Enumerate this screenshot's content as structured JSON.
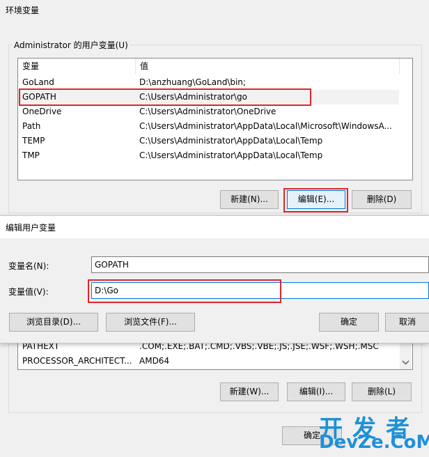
{
  "window": {
    "title": "环境变量"
  },
  "user_vars": {
    "group_label": "Administrator 的用户变量(U)",
    "col_name": "变量",
    "col_value": "值",
    "rows": [
      {
        "name": "GoLand",
        "value": "D:\\anzhuang\\GoLand\\bin;"
      },
      {
        "name": "GOPATH",
        "value": "C:\\Users\\Administrator\\go"
      },
      {
        "name": "OneDrive",
        "value": "C:\\Users\\Administrator\\OneDrive"
      },
      {
        "name": "Path",
        "value": "C:\\Users\\Administrator\\AppData\\Local\\Microsoft\\WindowsA..."
      },
      {
        "name": "TEMP",
        "value": "C:\\Users\\Administrator\\AppData\\Local\\Temp"
      },
      {
        "name": "TMP",
        "value": "C:\\Users\\Administrator\\AppData\\Local\\Temp"
      }
    ],
    "new_label": "新建(N)...",
    "edit_label": "编辑(E)...",
    "delete_label": "删除(D)"
  },
  "system_vars": {
    "rows": [
      {
        "name": "PATHEXT",
        "value": ".COM;.EXE;.BAT;.CMD;.VBS;.VBE;.JS;.JSE;.WSF;.WSH;.MSC"
      },
      {
        "name": "PROCESSOR_ARCHITECT...",
        "value": "AMD64"
      }
    ],
    "new_label": "新建(W)...",
    "edit_label": "编辑(I)...",
    "delete_label": "删除(L)"
  },
  "main_ok_label": "确定",
  "edit_dialog": {
    "title": "编辑用户变量",
    "name_label": "变量名(N):",
    "name_value": "GOPATH",
    "value_label": "变量值(V):",
    "value_value": "D:\\Go",
    "browse_dir_label": "浏览目录(D)...",
    "browse_file_label": "浏览文件(F)...",
    "ok_label": "确定",
    "cancel_label": "取消"
  },
  "watermark": {
    "line1": "开发者",
    "line2": "DevZe.CoM"
  },
  "colors": {
    "highlight": "#e0252b",
    "watermark": "#1e90d8"
  }
}
